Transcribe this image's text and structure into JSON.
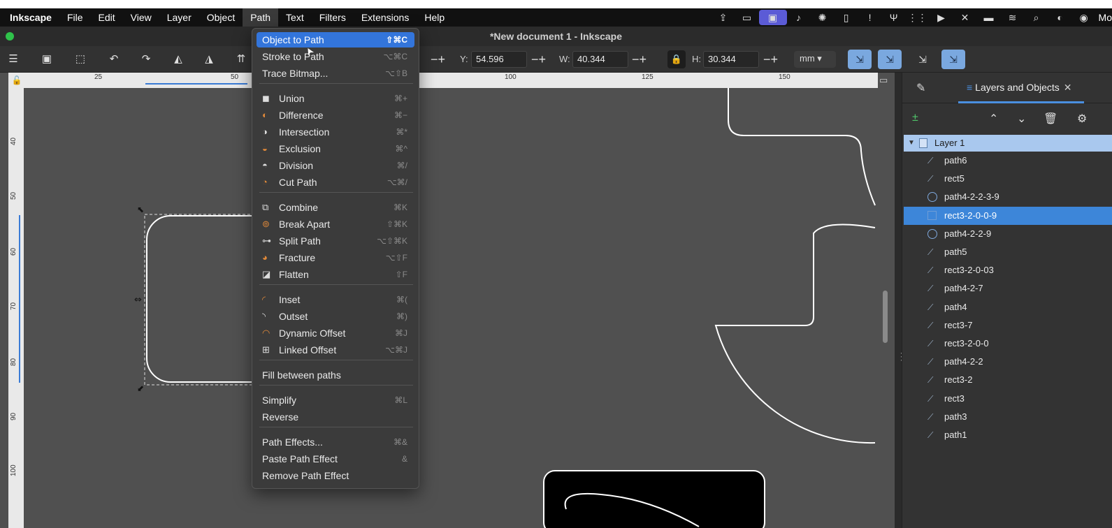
{
  "menubar": {
    "app": "Inkscape",
    "items": [
      "File",
      "Edit",
      "View",
      "Layer",
      "Object",
      "Path",
      "Text",
      "Filters",
      "Extensions",
      "Help"
    ],
    "active": "Path",
    "clock": "Mo"
  },
  "window": {
    "title": "*New document 1 - Inkscape"
  },
  "toolbar": {
    "y_label": "Y:",
    "y_value": "54.596",
    "w_label": "W:",
    "w_value": "40.344",
    "h_label": "H:",
    "h_value": "30.344",
    "unit": "mm"
  },
  "ruler": {
    "h_labels": [
      "25",
      "50",
      "100",
      "125",
      "150"
    ],
    "v_labels": [
      "40",
      "50",
      "60",
      "70",
      "80",
      "90",
      "100"
    ]
  },
  "path_menu": {
    "items": [
      {
        "label": "Object to Path",
        "shortcut": "⇧⌘C",
        "highlighted": true
      },
      {
        "label": "Stroke to Path",
        "shortcut": "⌥⌘C"
      },
      {
        "label": "Trace Bitmap...",
        "shortcut": "⌥⇧B"
      },
      {
        "label": "Union",
        "shortcut": "⌘+",
        "icon": "union-icon"
      },
      {
        "label": "Difference",
        "shortcut": "⌘−",
        "icon": "difference-icon"
      },
      {
        "label": "Intersection",
        "shortcut": "⌘*",
        "icon": "intersection-icon"
      },
      {
        "label": "Exclusion",
        "shortcut": "⌘^",
        "icon": "exclusion-icon"
      },
      {
        "label": "Division",
        "shortcut": "⌘/",
        "icon": "division-icon"
      },
      {
        "label": "Cut Path",
        "shortcut": "⌥⌘/",
        "icon": "cut-path-icon"
      },
      {
        "label": "Combine",
        "shortcut": "⌘K",
        "icon": "combine-icon"
      },
      {
        "label": "Break Apart",
        "shortcut": "⇧⌘K",
        "icon": "break-apart-icon"
      },
      {
        "label": "Split Path",
        "shortcut": "⌥⇧⌘K",
        "icon": "split-path-icon"
      },
      {
        "label": "Fracture",
        "shortcut": "⌥⇧F",
        "icon": "fracture-icon"
      },
      {
        "label": "Flatten",
        "shortcut": "⇧F",
        "icon": "flatten-icon"
      },
      {
        "label": "Inset",
        "shortcut": "⌘(",
        "icon": "inset-icon"
      },
      {
        "label": "Outset",
        "shortcut": "⌘)",
        "icon": "outset-icon"
      },
      {
        "label": "Dynamic Offset",
        "shortcut": "⌘J",
        "icon": "dynamic-offset-icon"
      },
      {
        "label": "Linked Offset",
        "shortcut": "⌥⌘J",
        "icon": "linked-offset-icon"
      },
      {
        "label": "Fill between paths",
        "shortcut": ""
      },
      {
        "label": "Simplify",
        "shortcut": "⌘L"
      },
      {
        "label": "Reverse",
        "shortcut": ""
      },
      {
        "label": "Path Effects...",
        "shortcut": "⌘&"
      },
      {
        "label": "Paste Path Effect",
        "shortcut": "&"
      },
      {
        "label": "Remove Path Effect",
        "shortcut": ""
      }
    ]
  },
  "panel": {
    "tab_label": "Layers and Objects",
    "layer": "Layer 1",
    "objects": [
      {
        "name": "path6",
        "type": "path"
      },
      {
        "name": "rect5",
        "type": "path"
      },
      {
        "name": "path4-2-2-3-9",
        "type": "circle"
      },
      {
        "name": "rect3-2-0-0-9",
        "type": "rect",
        "selected": true
      },
      {
        "name": "path4-2-2-9",
        "type": "circle"
      },
      {
        "name": "path5",
        "type": "path"
      },
      {
        "name": "rect3-2-0-03",
        "type": "path"
      },
      {
        "name": "path4-2-7",
        "type": "path"
      },
      {
        "name": "path4",
        "type": "path"
      },
      {
        "name": "rect3-7",
        "type": "path"
      },
      {
        "name": "rect3-2-0-0",
        "type": "path"
      },
      {
        "name": "path4-2-2",
        "type": "path"
      },
      {
        "name": "rect3-2",
        "type": "path"
      },
      {
        "name": "rect3",
        "type": "path"
      },
      {
        "name": "path3",
        "type": "path"
      },
      {
        "name": "path1",
        "type": "path"
      }
    ]
  },
  "colors": {
    "accent": "#3375db",
    "canvas": "#505050",
    "layer_row": "#a9c8ee"
  }
}
